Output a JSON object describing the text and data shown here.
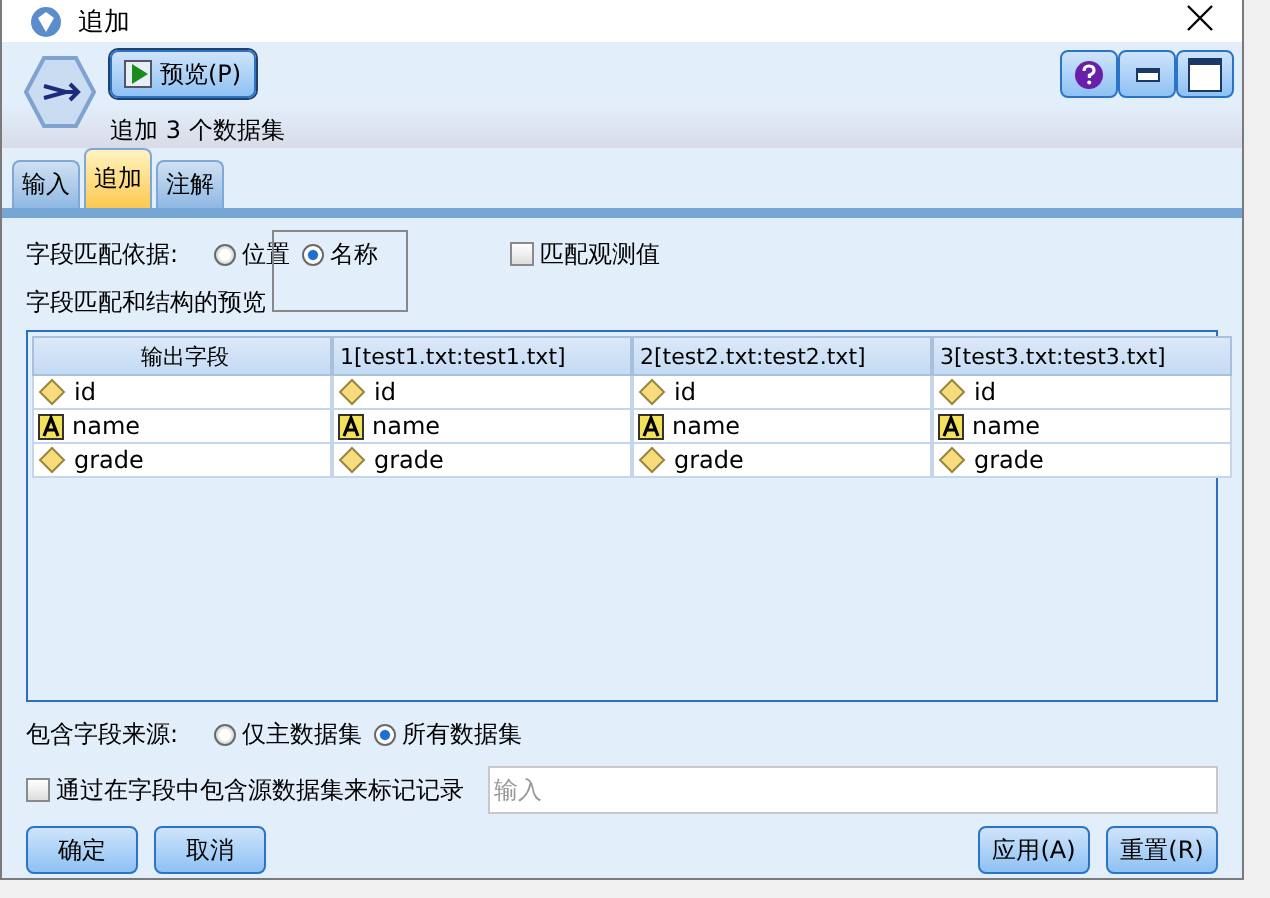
{
  "window": {
    "title": "追加"
  },
  "header": {
    "preview_button": "预览(P)",
    "subtitle": "追加 3 个数据集"
  },
  "tabs": [
    {
      "label": "输入",
      "selected": false
    },
    {
      "label": "追加",
      "selected": true
    },
    {
      "label": "注解",
      "selected": false
    }
  ],
  "match_by": {
    "label": "字段匹配依据:",
    "options": [
      {
        "label": "位置",
        "selected": false
      },
      {
        "label": "名称",
        "selected": true
      }
    ],
    "match_cases": {
      "label": "匹配观测值",
      "checked": false
    }
  },
  "preview": {
    "label": "字段匹配和结构的预览",
    "columns": [
      "输出字段",
      "1[test1.txt:test1.txt]",
      "2[test2.txt:test2.txt]",
      "3[test3.txt:test3.txt]"
    ],
    "rows": [
      {
        "kind": "numeric",
        "cells": [
          "id",
          "id",
          "id",
          "id"
        ]
      },
      {
        "kind": "string",
        "cells": [
          "name",
          "name",
          "name",
          "name"
        ]
      },
      {
        "kind": "numeric",
        "cells": [
          "grade",
          "grade",
          "grade",
          "grade"
        ]
      }
    ]
  },
  "include_from": {
    "label": "包含字段来源:",
    "options": [
      {
        "label": "仅主数据集",
        "selected": false
      },
      {
        "label": "所有数据集",
        "selected": true
      }
    ]
  },
  "tag_records": {
    "label": "通过在字段中包含源数据集来标记记录",
    "checked": false,
    "placeholder": "输入"
  },
  "buttons_left": [
    "确定",
    "取消"
  ],
  "buttons_right": [
    "应用(A)",
    "重置(R)"
  ]
}
